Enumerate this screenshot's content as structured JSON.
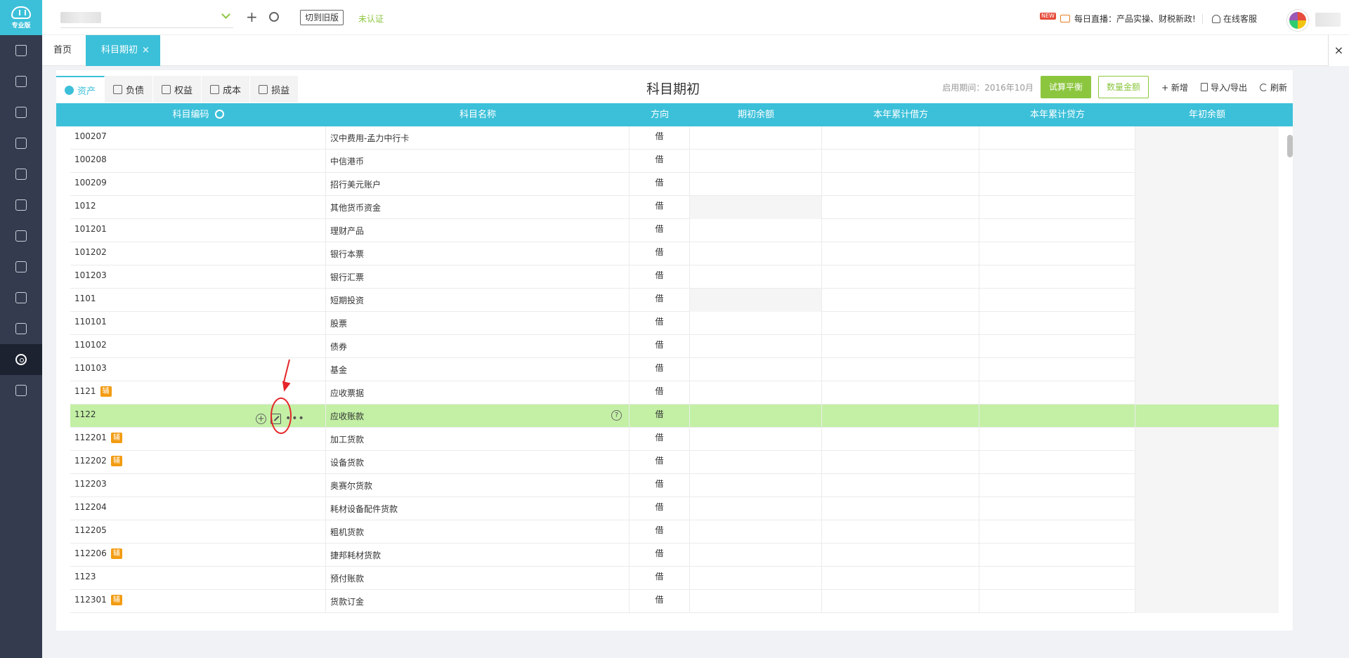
{
  "brand": {
    "logo_label": "专业版"
  },
  "topbar": {
    "switch_old_label": "切到旧版",
    "unverified_label": "未认证",
    "live_badge": "NEW",
    "live_text": "每日直播：产品实操、财税新政!",
    "service_label": "在线客服"
  },
  "tabs": {
    "home": "首页",
    "active": "科目期初",
    "active_close": "×",
    "close_all": "×"
  },
  "categories": [
    {
      "label": "资产"
    },
    {
      "label": "负债"
    },
    {
      "label": "权益"
    },
    {
      "label": "成本"
    },
    {
      "label": "损益"
    }
  ],
  "page": {
    "title": "科目期初",
    "period_text": "启用期间：2016年10月",
    "trial_balance_label": "试算平衡",
    "quantity_amount_label": "数量金额",
    "add_label": "+ 新增",
    "import_export_label": "导入/导出",
    "refresh_label": "刷新"
  },
  "columns": {
    "code": "科目编码",
    "name": "科目名称",
    "direction": "方向",
    "opening": "期初余额",
    "ytd_debit": "本年累计借方",
    "ytd_credit": "本年累计贷方",
    "year_open": "年初余额"
  },
  "rows": [
    {
      "code": "100207",
      "name": "汉中费用-孟力中行卡",
      "dir": "借",
      "aux": ""
    },
    {
      "code": "100208",
      "name": "中信港币",
      "dir": "借",
      "aux": ""
    },
    {
      "code": "100209",
      "name": "招行美元账户",
      "dir": "借",
      "aux": ""
    },
    {
      "code": "1012",
      "name": "其他货币资金",
      "dir": "借",
      "aux": ""
    },
    {
      "code": "101201",
      "name": "理财产品",
      "dir": "借",
      "aux": ""
    },
    {
      "code": "101202",
      "name": "银行本票",
      "dir": "借",
      "aux": ""
    },
    {
      "code": "101203",
      "name": "银行汇票",
      "dir": "借",
      "aux": ""
    },
    {
      "code": "1101",
      "name": "短期投资",
      "dir": "借",
      "aux": ""
    },
    {
      "code": "110101",
      "name": "股票",
      "dir": "借",
      "aux": ""
    },
    {
      "code": "110102",
      "name": "债券",
      "dir": "借",
      "aux": ""
    },
    {
      "code": "110103",
      "name": "基金",
      "dir": "借",
      "aux": ""
    },
    {
      "code": "1121",
      "name": "应收票据",
      "dir": "借",
      "aux": "辅"
    },
    {
      "code": "1122",
      "name": "应收账款",
      "dir": "借",
      "aux": ""
    },
    {
      "code": "112201",
      "name": "加工货款",
      "dir": "借",
      "aux": "辅"
    },
    {
      "code": "112202",
      "name": "设备货款",
      "dir": "借",
      "aux": "辅"
    },
    {
      "code": "112203",
      "name": "奥赛尔货款",
      "dir": "借",
      "aux": ""
    },
    {
      "code": "112204",
      "name": "耗材设备配件货款",
      "dir": "借",
      "aux": ""
    },
    {
      "code": "112205",
      "name": "粗机货款",
      "dir": "借",
      "aux": ""
    },
    {
      "code": "112206",
      "name": "捷邦耗材货款",
      "dir": "借",
      "aux": "辅"
    },
    {
      "code": "1123",
      "name": "预付账款",
      "dir": "借",
      "aux": ""
    },
    {
      "code": "112301",
      "name": "货款订金",
      "dir": "借",
      "aux": "辅"
    }
  ],
  "row_actions": {
    "add": "+",
    "more": "•••",
    "help": "?"
  }
}
